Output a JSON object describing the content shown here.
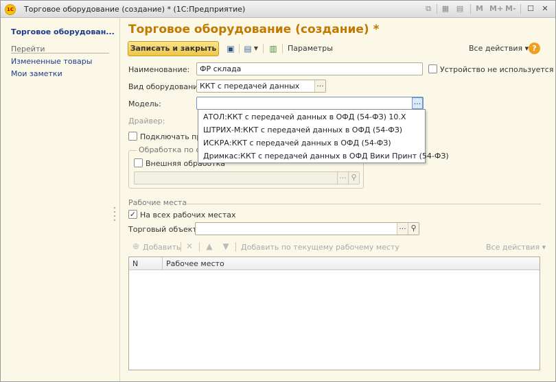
{
  "window": {
    "title": "Торговое оборудование (создание) * (1С:Предприятие)",
    "logo_text": "1С",
    "tb_m": "M",
    "tb_mplus": "M+",
    "tb_mminus": "M-"
  },
  "leftpanel": {
    "title": "Торговое оборудован...",
    "goto": "Перейти",
    "links": [
      "Измененные товары",
      "Мои заметки"
    ]
  },
  "form": {
    "title": "Торговое оборудование (создание) *",
    "save_close": "Записать и закрыть",
    "params": "Параметры",
    "all_actions": "Все действия ▾",
    "help": "?"
  },
  "fields": {
    "name_label": "Наименование:",
    "name_value": "ФР склада",
    "unused_label": "Устройство не используется",
    "type_label": "Вид оборудования:",
    "type_value": "ККТ с передачей данных",
    "model_label": "Модель:",
    "model_value": "",
    "driver_label": "Драйвер:",
    "connect_label": "Подключать при",
    "processing_legend": "Обработка по об",
    "external_label": "Внешняя обработка",
    "pick_dots": "...",
    "search_glyph": "⚲"
  },
  "workplaces": {
    "section_label": "Рабочие места",
    "all_workplaces_label": "На всех рабочих местах",
    "trade_object_label": "Торговый объект:",
    "trade_object_value": "",
    "add": "Добавить",
    "add_current": "Добавить по текущему рабочему месту",
    "all_actions": "Все действия ▾",
    "columns": [
      "N",
      "Рабочее место"
    ]
  },
  "dropdown": {
    "items": [
      "АТОЛ:ККТ с передачей данных в ОФД (54-ФЗ) 10.Х",
      "ШТРИХ-М:ККТ с передачей данных в ОФД (54-ФЗ)",
      "ИСКРА:ККТ с передачей данных в ОФД (54-ФЗ)",
      "Дримкас:ККТ с передачей данных в ОФД Вики Принт (54-ФЗ)"
    ]
  }
}
